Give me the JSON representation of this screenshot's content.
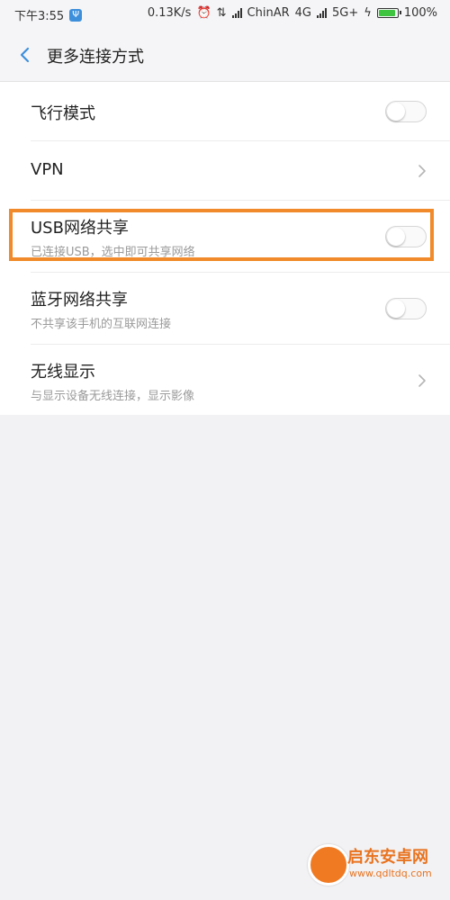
{
  "status_bar": {
    "time": "下午3:55",
    "usb_icon": "usb-icon",
    "speed": "0.13K/s",
    "carrier": "ChinAR",
    "net1": "4G",
    "net2": "5G+",
    "battery": "100%",
    "battery_level": 1.0
  },
  "header": {
    "title": "更多连接方式"
  },
  "items": [
    {
      "label": "飞行模式",
      "control": "toggle",
      "on": false
    },
    {
      "label": "VPN",
      "control": "chevron"
    },
    {
      "label": "USB网络共享",
      "sub": "已连接USB，选中即可共享网络",
      "control": "toggle",
      "on": false
    },
    {
      "label": "蓝牙网络共享",
      "sub": "不共享该手机的互联网连接",
      "control": "toggle",
      "on": false
    },
    {
      "label": "无线显示",
      "sub": "与显示设备无线连接，显示影像",
      "control": "chevron"
    }
  ],
  "watermark": {
    "name": "启东安卓网",
    "url": "www.qdltdq.com"
  },
  "colors": {
    "highlight": "#f08a2a",
    "accent": "#3d8fdc"
  }
}
